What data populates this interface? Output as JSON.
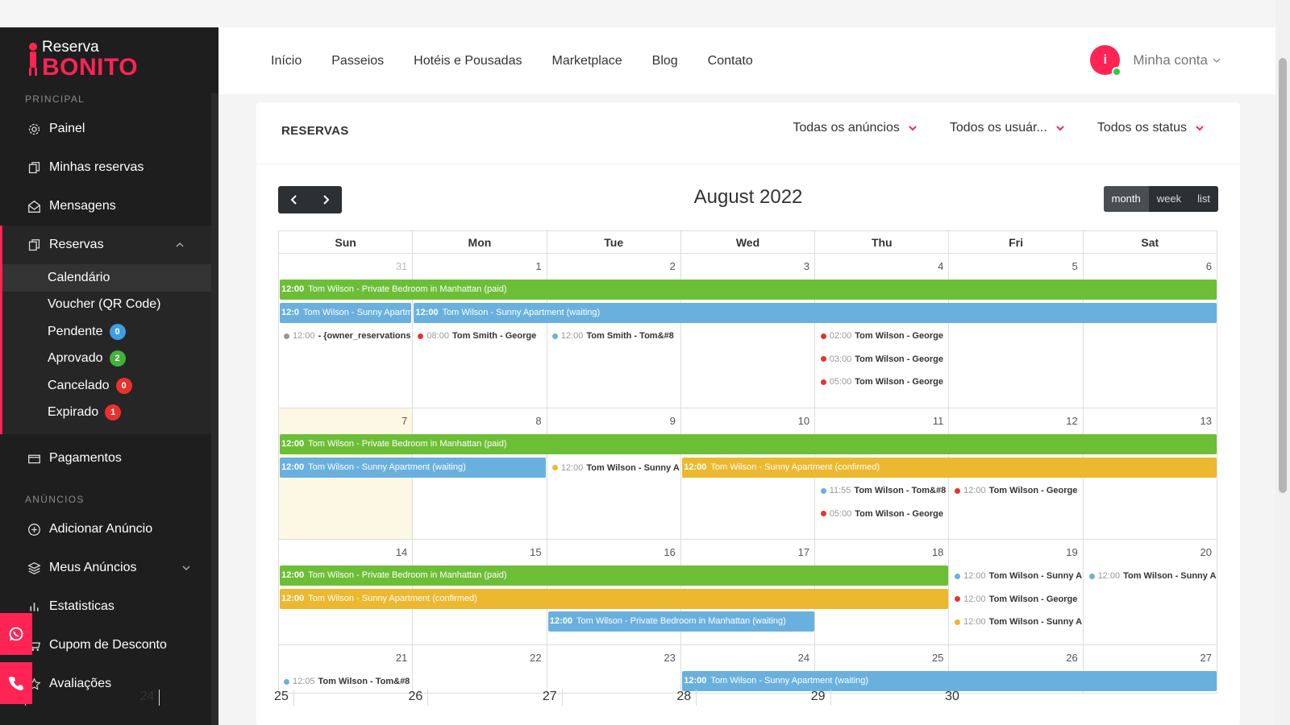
{
  "brand": {
    "line1": "Reserva",
    "line2": "BONITO"
  },
  "sidebar": {
    "section_principal": "PRINCIPAL",
    "section_anuncios": "ANÚNCIOS",
    "painel": "Painel",
    "minhas_reservas": "Minhas reservas",
    "mensagens": "Mensagens",
    "reservas": "Reservas",
    "subitems": [
      {
        "label": "Calendário"
      },
      {
        "label": "Voucher (QR Code)"
      },
      {
        "label": "Pendente",
        "badge": "0",
        "badge_color": "#3d9ee4"
      },
      {
        "label": "Aprovado",
        "badge": "2",
        "badge_color": "#3fb439"
      },
      {
        "label": "Cancelado",
        "badge": "0",
        "badge_color": "#e9312f"
      },
      {
        "label": "Expirado",
        "badge": "1",
        "badge_color": "#e9312f"
      }
    ],
    "pagamentos": "Pagamentos",
    "adicionar_anuncio": "Adicionar Anúncio",
    "meus_anuncios": "Meus Anúncios",
    "estatisticas": "Estatisticas",
    "cupom": "Cupom de Desconto",
    "avaliacoes": "Avaliações"
  },
  "nav": {
    "inicio": "Início",
    "passeios": "Passeios",
    "hoteis": "Hotéis e Pousadas",
    "marketplace": "Marketplace",
    "blog": "Blog",
    "contato": "Contato"
  },
  "account": {
    "label": "Minha conta",
    "avatar_glyph": "i"
  },
  "panel": {
    "title": "RESERVAS",
    "filter_anuncios": "Todas os anúncios",
    "filter_usuarios": "Todos os usuár...",
    "filter_status": "Todos os status"
  },
  "calendar": {
    "title": "August 2022",
    "views": {
      "month": "month",
      "week": "week",
      "list": "list"
    },
    "days": [
      "Sun",
      "Mon",
      "Tue",
      "Wed",
      "Thu",
      "Fri",
      "Sat"
    ],
    "last_row_numbers": [
      "24",
      "25",
      "26",
      "27",
      "28",
      "29",
      "30"
    ],
    "weeks": [
      {
        "nums": [
          "31",
          "1",
          "2",
          "3",
          "4",
          "5",
          "6"
        ],
        "other": [
          0
        ],
        "today": -1,
        "height": 192,
        "bars": [
          {
            "start": 0,
            "span": 7,
            "lane": 0,
            "color": "green",
            "time": "12:00",
            "text": "Tom Wilson - Private Bedroom in Manhattan (paid)"
          },
          {
            "start": 0,
            "span": 1,
            "lane": 1,
            "color": "blue",
            "time": "12:0",
            "text": "Tom Wilson - Sunny Apartment (waiting)"
          },
          {
            "start": 1,
            "span": 6,
            "lane": 1,
            "color": "blue",
            "time": "12:00",
            "text": "Tom Wilson - Sunny Apartment (waiting)"
          }
        ],
        "dots": [
          {
            "col": 0,
            "lane": 2,
            "color": "#999999",
            "time": "12:00",
            "text": "- {owner_reservations}"
          },
          {
            "col": 1,
            "lane": 2,
            "color": "#e9312f",
            "time": "08:00",
            "text": "Tom Smith - George"
          },
          {
            "col": 2,
            "lane": 2,
            "color": "#6ab0de",
            "time": "12:00",
            "text": "Tom Smith - Tom&#8"
          },
          {
            "col": 4,
            "lane": 2,
            "color": "#e9312f",
            "time": "02:00",
            "text": "Tom Wilson - George"
          },
          {
            "col": 4,
            "lane": 3,
            "color": "#e9312f",
            "time": "03:00",
            "text": "Tom Wilson - George"
          },
          {
            "col": 4,
            "lane": 4,
            "color": "#e9312f",
            "time": "05:00",
            "text": "Tom Wilson - George"
          }
        ]
      },
      {
        "nums": [
          "7",
          "8",
          "9",
          "10",
          "11",
          "12",
          "13"
        ],
        "other": [],
        "today": 0,
        "height": 163,
        "bars": [
          {
            "start": 0,
            "span": 7,
            "lane": 0,
            "color": "green",
            "time": "12:00",
            "text": "Tom Wilson - Private Bedroom in Manhattan (paid)"
          },
          {
            "start": 0,
            "span": 2,
            "lane": 1,
            "color": "blue",
            "time": "12:00",
            "text": "Tom Wilson - Sunny Apartment (waiting)"
          },
          {
            "start": 3,
            "span": 4,
            "lane": 1,
            "color": "yellow",
            "time": "12:00",
            "text": "Tom Wilson - Sunny Apartment (confirmed)"
          }
        ],
        "dots": [
          {
            "col": 2,
            "lane": 1,
            "color": "#ecb830",
            "time": "12:00",
            "text": "Tom Wilson - Sunny A"
          },
          {
            "col": 4,
            "lane": 2,
            "color": "#6ab0de",
            "time": "11:55",
            "text": "Tom Wilson - Tom&#8"
          },
          {
            "col": 5,
            "lane": 2,
            "color": "#e9312f",
            "time": "12:00",
            "text": "Tom Wilson - George"
          },
          {
            "col": 4,
            "lane": 3,
            "color": "#e9312f",
            "time": "05:00",
            "text": "Tom Wilson - George"
          }
        ]
      },
      {
        "nums": [
          "14",
          "15",
          "16",
          "17",
          "18",
          "19",
          "20"
        ],
        "other": [],
        "today": -1,
        "height": 131,
        "bars": [
          {
            "start": 0,
            "span": 5,
            "lane": 0,
            "color": "green",
            "time": "12:00",
            "text": "Tom Wilson - Private Bedroom in Manhattan (paid)"
          },
          {
            "start": 0,
            "span": 5,
            "lane": 1,
            "color": "yellow",
            "time": "12:00",
            "text": "Tom Wilson - Sunny Apartment (confirmed)"
          },
          {
            "start": 2,
            "span": 2,
            "lane": 2,
            "color": "blue",
            "time": "12:00",
            "text": "Tom Wilson - Private Bedroom in Manhattan (waiting)"
          }
        ],
        "dots": [
          {
            "col": 5,
            "lane": 0,
            "color": "#6ab0de",
            "time": "12:00",
            "text": "Tom Wilson - Sunny A"
          },
          {
            "col": 6,
            "lane": 0,
            "color": "#6ab0de",
            "time": "12:00",
            "text": "Tom Wilson - Sunny A"
          },
          {
            "col": 5,
            "lane": 1,
            "color": "#e9312f",
            "time": "12:00",
            "text": "Tom Wilson - George"
          },
          {
            "col": 5,
            "lane": 2,
            "color": "#ecb830",
            "time": "12:00",
            "text": "Tom Wilson - Sunny A"
          }
        ]
      },
      {
        "nums": [
          "21",
          "22",
          "23",
          "24",
          "25",
          "26",
          "27"
        ],
        "other": [],
        "today": -1,
        "height": 60,
        "bars": [
          {
            "start": 3,
            "span": 4,
            "lane": 0,
            "color": "blue",
            "time": "12:00",
            "text": "Tom Wilson - Sunny Apartment (waiting)"
          }
        ],
        "dots": [
          {
            "col": 0,
            "lane": 0,
            "color": "#6ab0de",
            "time": "12:05",
            "text": "Tom Wilson - Tom&#8"
          }
        ]
      }
    ]
  }
}
